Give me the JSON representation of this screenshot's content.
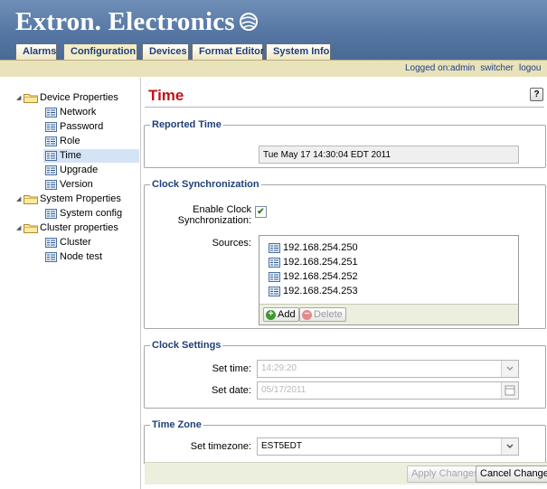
{
  "header": {
    "brand_text": "Extron. Electronics",
    "logo_icon": "extron-swirl-logo-icon",
    "tabs": [
      {
        "label": "Alarms",
        "active": false
      },
      {
        "label": "Configuration",
        "active": true
      },
      {
        "label": "Devices",
        "active": false
      },
      {
        "label": "Format Editor",
        "active": false
      },
      {
        "label": "System Info",
        "active": false
      }
    ]
  },
  "infobar": {
    "logged_text": "Logged on:admin",
    "switcher_link": "switcher",
    "logout_link": "logou"
  },
  "sidebar": {
    "groups": [
      {
        "label": "Device Properties",
        "icon": "folder-icon",
        "items": [
          "Network",
          "Password",
          "Role",
          "Time",
          "Upgrade",
          "Version"
        ]
      },
      {
        "label": "System Properties",
        "icon": "folder-icon",
        "items": [
          "System config"
        ]
      },
      {
        "label": "Cluster properties",
        "icon": "folder-icon",
        "items": [
          "Cluster",
          "Node test"
        ]
      }
    ],
    "selected_item": "Time"
  },
  "page": {
    "title": "Time",
    "help_label": "?"
  },
  "reported_time": {
    "legend": "Reported Time",
    "value": "Tue May 17 14:30:04 EDT 2011"
  },
  "clock_sync": {
    "legend": "Clock Synchronization",
    "enable_label_line1": "Enable Clock",
    "enable_label_line2": "Synchronization:",
    "enabled": true,
    "sources_label": "Sources:",
    "sources": [
      "192.168.254.250",
      "192.168.254.251",
      "192.168.254.252",
      "192.168.254.253"
    ],
    "add_label": "Add",
    "delete_label": "Delete"
  },
  "clock_settings": {
    "legend": "Clock Settings",
    "set_time_label": "Set time:",
    "set_time_value": "14:29:20",
    "set_date_label": "Set date:",
    "set_date_value": "05/17/2011"
  },
  "time_zone": {
    "legend": "Time Zone",
    "label": "Set timezone:",
    "value": "EST5EDT"
  },
  "actions": {
    "apply_label": "Apply Changes",
    "cancel_label": "Cancel Changes"
  },
  "colors": {
    "header_blue": "#5677a3",
    "title_red": "#c0131c",
    "legend_blue": "#1f3f78",
    "tab_cream": "#f1e7c2"
  }
}
